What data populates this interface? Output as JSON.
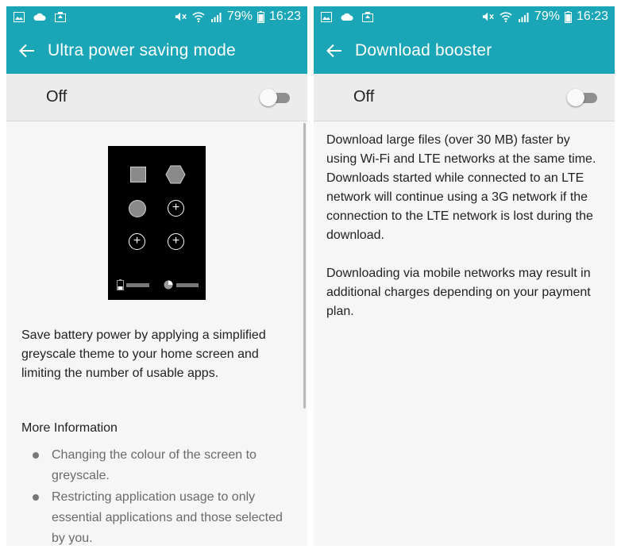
{
  "status_bar": {
    "battery_percent": "79%",
    "time": "16:23",
    "left_icons": [
      "gallery-icon",
      "cloud-icon",
      "photo-upload-icon"
    ],
    "right_icons": [
      "mute-icon",
      "wifi-icon",
      "signal-icon",
      "battery-icon"
    ]
  },
  "left_screen": {
    "title": "Ultra power saving mode",
    "toggle_label": "Off",
    "toggle_state": "off",
    "description": "Save battery power by applying a simplified greyscale theme to your home screen and limiting the number of usable apps.",
    "more_info_title": "More Information",
    "bullets": [
      "Changing the colour of the screen to greyscale.",
      "Restricting application usage to only essential applications and those selected by you."
    ]
  },
  "right_screen": {
    "title": "Download booster",
    "toggle_label": "Off",
    "toggle_state": "off",
    "paragraphs": [
      "Download large files (over 30 MB) faster by using Wi-Fi and LTE networks at the same time. Downloads started while connected to an LTE network will continue using a 3G network if the connection to the LTE network is lost during the download.",
      "Downloading via mobile networks may result in additional charges depending on your payment plan."
    ]
  },
  "colors": {
    "accent": "#1aa6b7",
    "toggle_row_bg": "#ececec",
    "background": "#f6f6f6"
  }
}
